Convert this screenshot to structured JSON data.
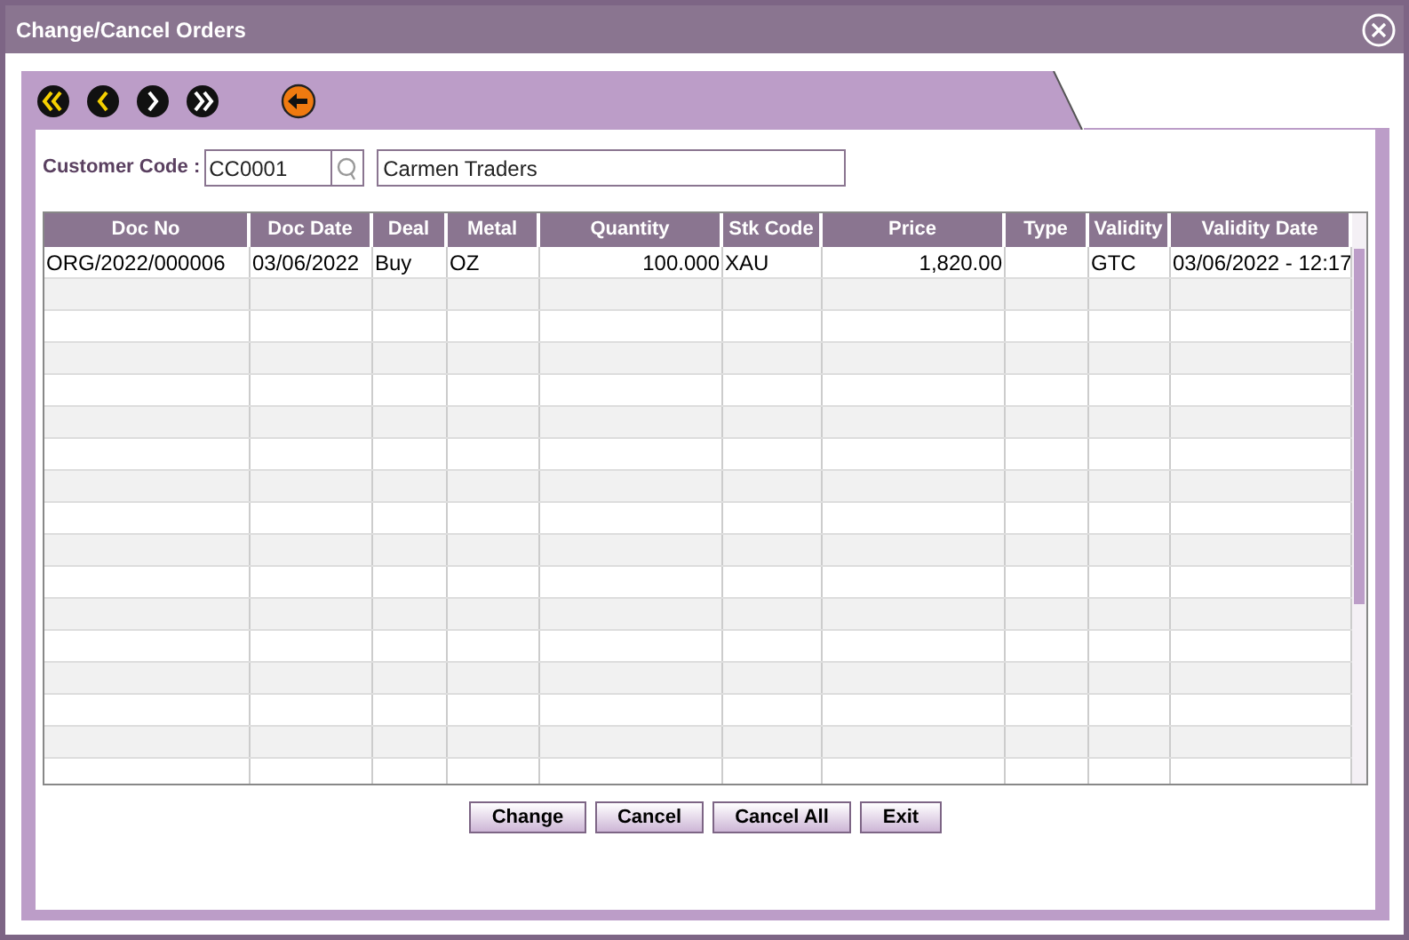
{
  "window": {
    "title": "Change/Cancel Orders"
  },
  "customer": {
    "label": "Customer Code :",
    "code": "CC0001",
    "name": "Carmen Traders"
  },
  "table": {
    "columns": [
      "Doc No",
      "Doc Date",
      "Deal",
      "Metal",
      "Quantity",
      "Stk Code",
      "Price",
      "Type",
      "Validity",
      "Validity Date"
    ],
    "rows": [
      [
        "ORG/2022/000006",
        "03/06/2022",
        "Buy",
        "OZ",
        "100.000",
        "XAU",
        "1,820.00",
        "",
        "GTC",
        "03/06/2022 - 12:17"
      ]
    ]
  },
  "buttons": [
    "Change",
    "Cancel",
    "Cancel All",
    "Exit"
  ]
}
